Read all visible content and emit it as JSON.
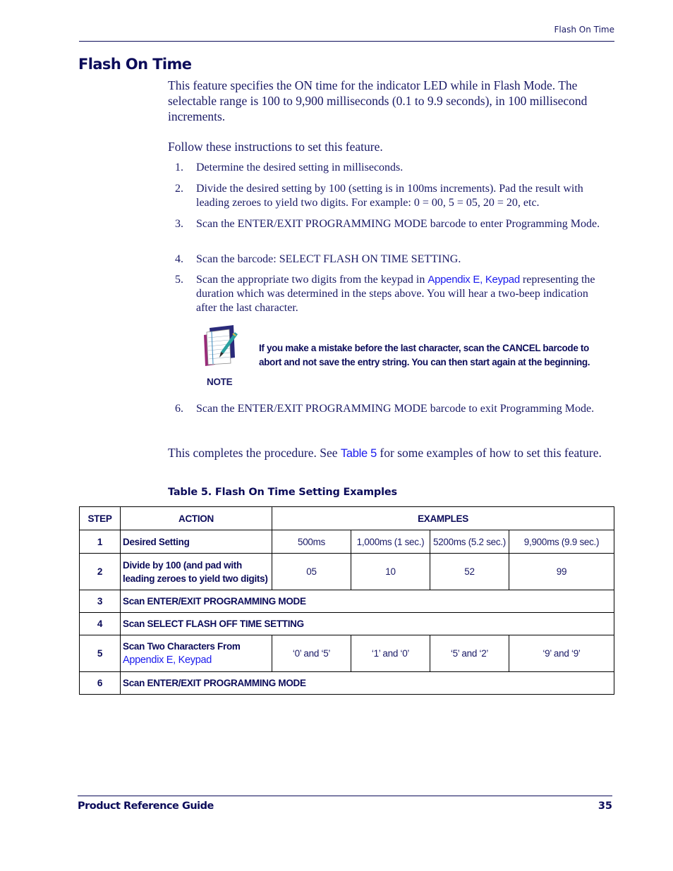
{
  "header": {
    "running_title": "Flash On Time"
  },
  "section": {
    "title": "Flash On Time",
    "intro": "This feature specifies the ON time for the indicator LED while in Flash Mode. The selectable range is 100 to 9,900 milliseconds (0.1 to 9.9 seconds), in 100 millisecond increments.",
    "follow": "Follow these instructions to set this feature."
  },
  "steps": [
    {
      "num": "1.",
      "text": "Determine the desired setting in milliseconds."
    },
    {
      "num": "2.",
      "text": "Divide the desired setting by 100 (setting is in 100ms increments). Pad the result with leading zeroes to yield two digits. For example: 0 = 00, 5 = 05, 20 = 20, etc."
    },
    {
      "num": "3.",
      "text": "Scan the ENTER/EXIT PROGRAMMING MODE barcode to enter Programming Mode."
    },
    {
      "num": "4.",
      "text": "Scan the barcode: SELECT FLASH ON TIME SETTING."
    },
    {
      "num": "5.",
      "text_before": "Scan the appropriate two digits from the keypad in ",
      "link": "Appendix E, Keypad",
      "text_after": " representing the duration which was determined in the steps above. You will hear a two-beep indication after the last character."
    },
    {
      "num": "6.",
      "text": "Scan the ENTER/EXIT PROGRAMMING MODE barcode to exit Programming Mode."
    }
  ],
  "note": {
    "icon": "note-pad-pen-icon",
    "label": "NOTE",
    "text": "If you make a mistake before the last character, scan the CANCEL barcode to abort and not save the entry string. You can then start again at the beginning."
  },
  "complete": {
    "before": "This completes the procedure. See ",
    "link": "Table 5",
    "after": " for some examples of how to set this feature."
  },
  "table": {
    "caption": "Table 5. Flash On Time Setting Examples",
    "headers": {
      "step": "STEP",
      "action": "ACTION",
      "examples": "EXAMPLES"
    },
    "rows": [
      {
        "step": "1",
        "action": "Desired Setting",
        "examples": [
          "500ms",
          "1,000ms (1 sec.)",
          "5200ms (5.2 sec.)",
          "9,900ms (9.9 sec.)"
        ]
      },
      {
        "step": "2",
        "action": "Divide by 100 (and pad with leading zeroes to yield two digits)",
        "examples": [
          "05",
          "10",
          "52",
          "99"
        ]
      },
      {
        "step": "3",
        "action": "Scan ENTER/EXIT PROGRAMMING MODE"
      },
      {
        "step": "4",
        "action": "Scan SELECT FLASH OFF TIME SETTING"
      },
      {
        "step": "5",
        "action": "Scan Two Characters From",
        "action_link": "Appendix E, Keypad",
        "examples": [
          "‘0’ and ‘5’",
          "‘1’ and ‘0’",
          "‘5’ and ‘2’",
          "‘9’ and ‘9’"
        ]
      },
      {
        "step": "6",
        "action": "Scan ENTER/EXIT PROGRAMMING MODE"
      }
    ]
  },
  "footer": {
    "guide_title": "Product Reference Guide",
    "page_number": "35"
  },
  "colors": {
    "text": "#1a1a66",
    "heading": "#0c0c5a",
    "link": "#1a1aee"
  }
}
